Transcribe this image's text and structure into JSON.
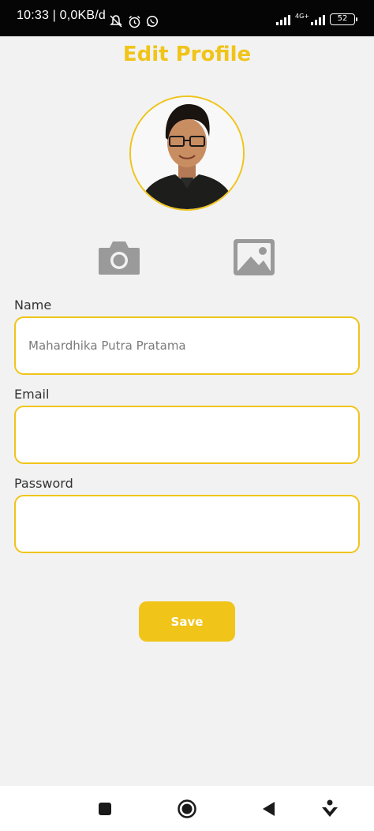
{
  "status_bar": {
    "time": "10:33 | 0,0KB/d",
    "network_label": "4G+",
    "battery_level": "52"
  },
  "page": {
    "title": "Edit Profile"
  },
  "form": {
    "name_label": "Name",
    "name_value": "Mahardhika Putra Pratama",
    "email_label": "Email",
    "email_value": "",
    "password_label": "Password",
    "password_value": ""
  },
  "actions": {
    "save_label": "Save",
    "camera_icon": "camera-icon",
    "gallery_icon": "image-gallery-icon"
  },
  "colors": {
    "accent": "#f0c419",
    "background": "#f2f2f2",
    "icon_gray": "#9a9a9a"
  }
}
